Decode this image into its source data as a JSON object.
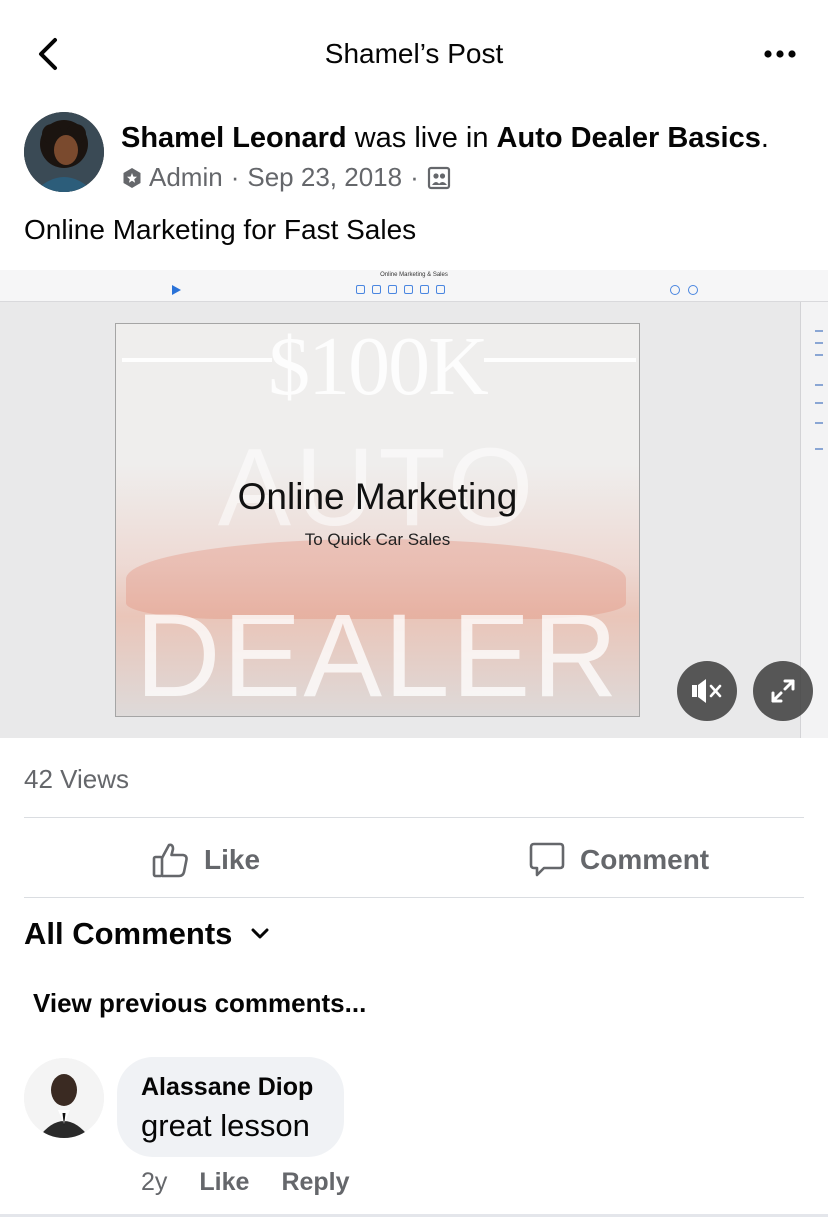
{
  "header": {
    "title": "Shamel’s Post",
    "back_icon": "chevron-left-icon",
    "more_icon": "more-horizontal-icon"
  },
  "post": {
    "author": "Shamel Leonard",
    "action_text": "was live in",
    "group": "Auto Dealer Basics",
    "period": ".",
    "role": "Admin",
    "date": "Sep 23, 2018",
    "separator": "·",
    "audience_icon": "group-icon",
    "text": "Online Marketing for Fast Sales"
  },
  "video": {
    "toolbar_title": "Online Marketing & Sales",
    "slide_title": "Online Marketing",
    "slide_subtitle": "To Quick Car Sales",
    "watermark_price": "$100K",
    "watermark_auto": "AUTO",
    "watermark_dealer": "DEALER",
    "mute_icon": "speaker-muted-icon",
    "fullscreen_icon": "expand-icon"
  },
  "stats": {
    "views": "42 Views"
  },
  "actions": {
    "like_label": "Like",
    "comment_label": "Comment"
  },
  "comments": {
    "filter_label": "All Comments",
    "view_previous": "View previous comments...",
    "items": [
      {
        "author": "Alassane Diop",
        "text": "great lesson",
        "age": "2y",
        "like_label": "Like",
        "reply_label": "Reply"
      }
    ]
  },
  "colors": {
    "text_primary": "#050505",
    "text_secondary": "#65676b",
    "bubble_bg": "#f0f2f5",
    "divider": "#dadde1"
  }
}
